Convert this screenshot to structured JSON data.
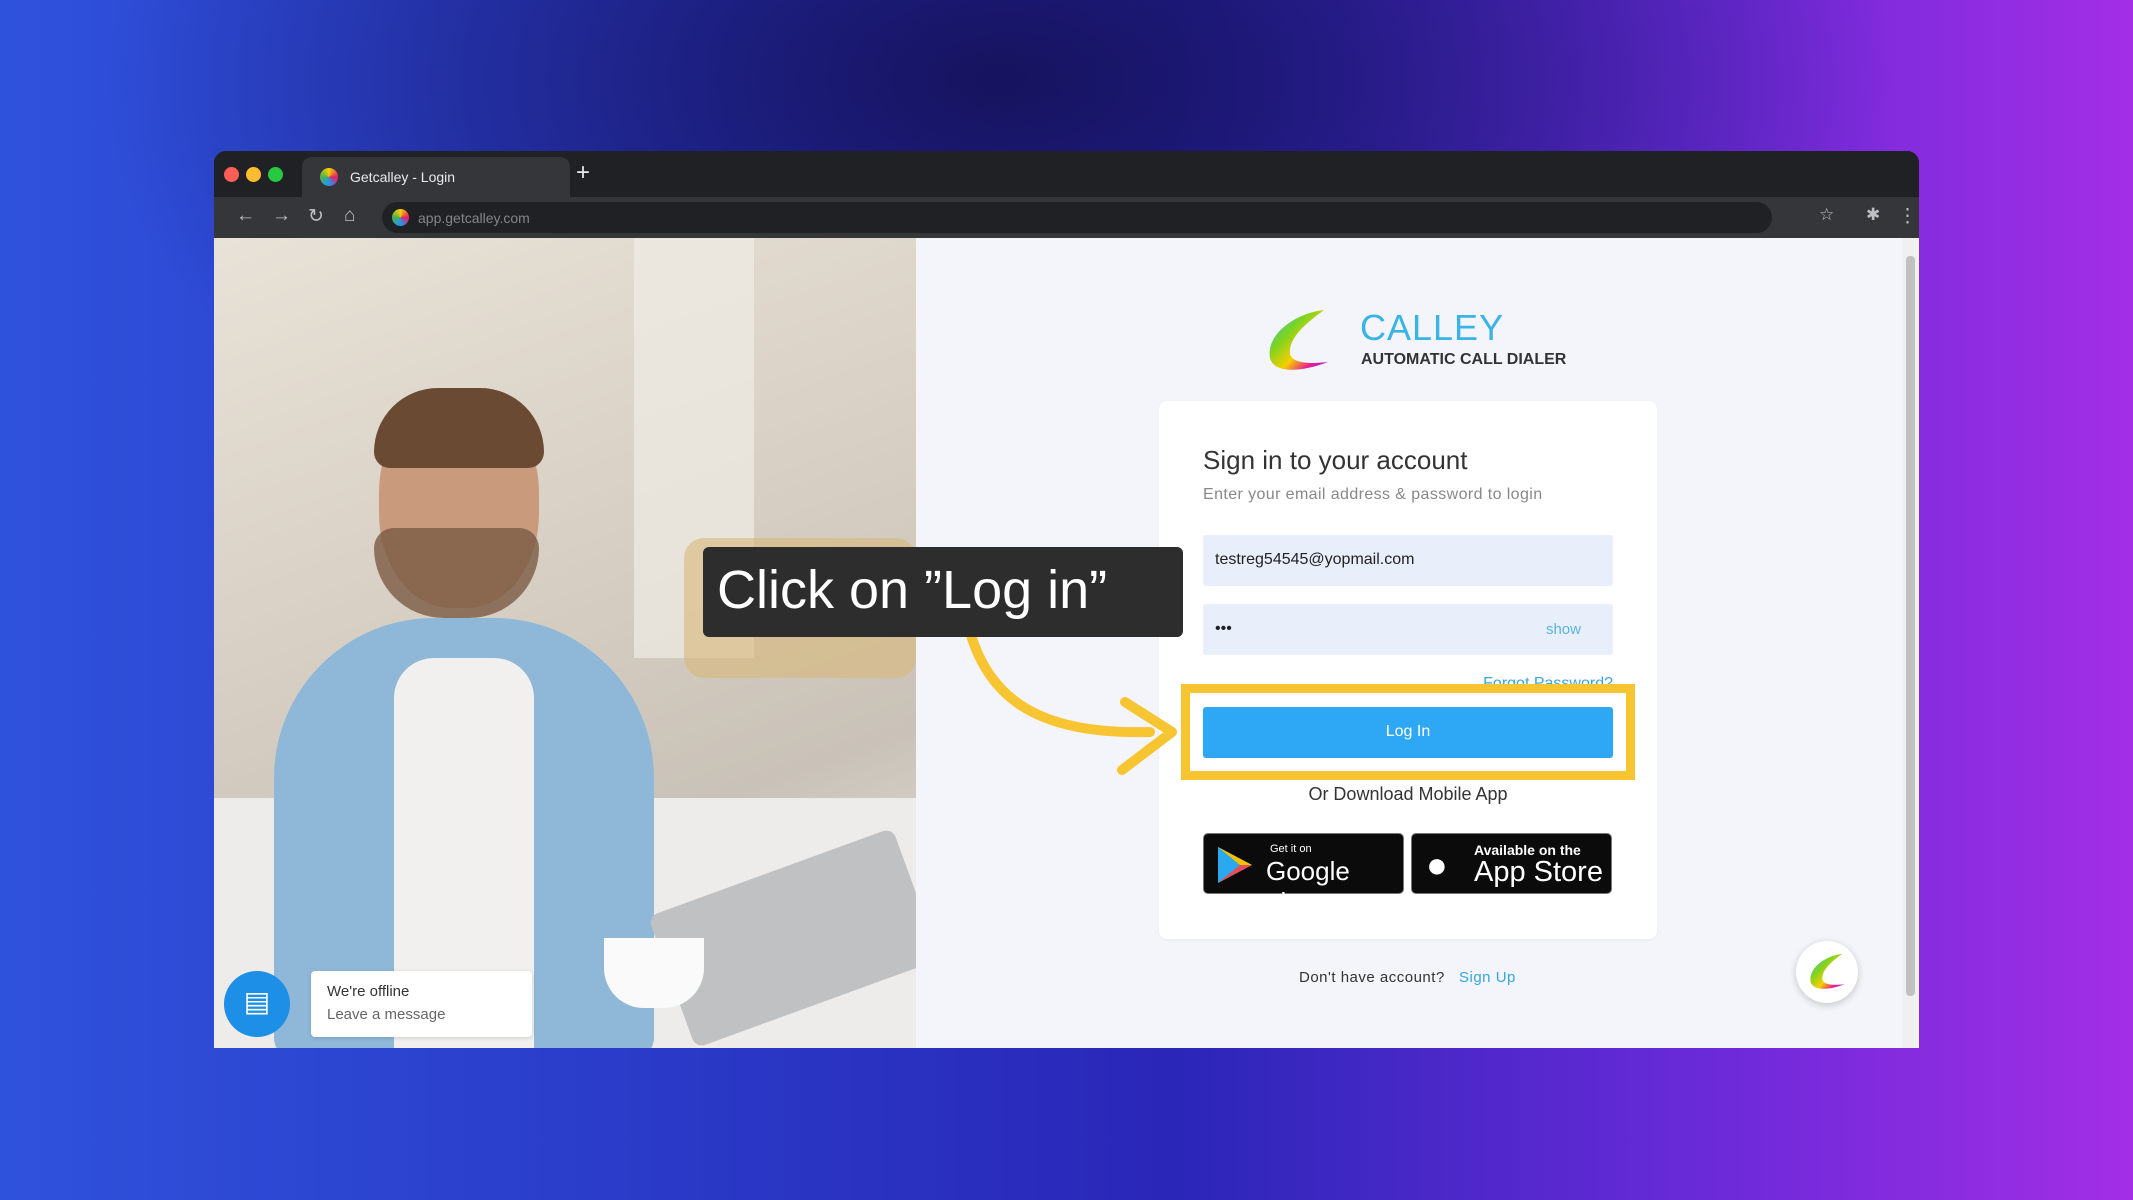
{
  "browser": {
    "tab_title": "Getcalley - Login",
    "new_tab": "+",
    "url": "app.getcalley.com"
  },
  "brand": {
    "name": "CALLEY",
    "tagline": "AUTOMATIC CALL DIALER"
  },
  "login": {
    "title": "Sign in to your account",
    "subtitle": "Enter your email address & password to login",
    "email_value": "testreg54545@yopmail.com",
    "password_value": "•••",
    "show_label": "show",
    "forgot_label": "Forgot Password?",
    "login_label": "Log In",
    "download_label": "Or Download Mobile App",
    "google_small": "Get it on",
    "google_big": "Google play",
    "apple_small": "Available on the",
    "apple_big": "App Store",
    "no_account": "Don't have account?",
    "signup_label": "Sign Up"
  },
  "chat": {
    "status": "We're offline",
    "action": "Leave a message"
  },
  "annotation": {
    "callout": "Click on ”Log in”"
  },
  "colors": {
    "primary": "#2ea8f5",
    "highlight": "#f7c531",
    "link": "#35a6e0"
  }
}
